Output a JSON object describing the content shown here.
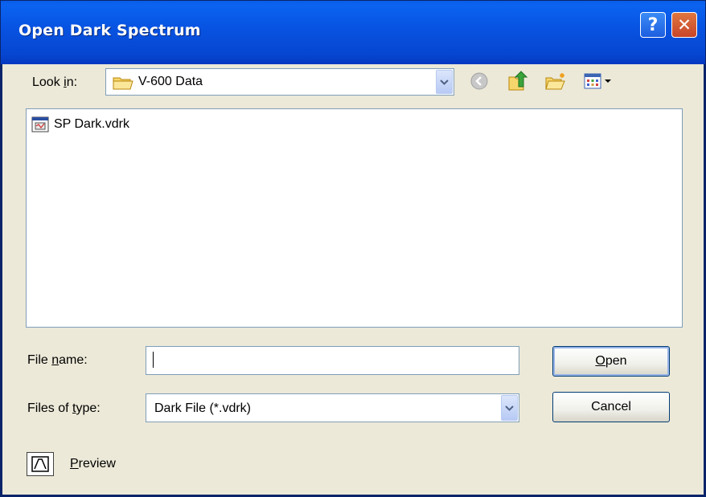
{
  "window": {
    "title": "Open Dark Spectrum",
    "help_glyph": "?",
    "close_glyph": "✕"
  },
  "look_in": {
    "label_prefix": "Look ",
    "label_accel": "i",
    "label_suffix": "n:",
    "value": "V-600 Data",
    "icon": "folder-icon"
  },
  "toolbar": {
    "icons": [
      "back-icon",
      "up-folder-icon",
      "new-folder-icon",
      "view-menu-icon"
    ]
  },
  "files": [
    {
      "name": "SP Dark.vdrk",
      "icon": "vdrk-file-icon"
    }
  ],
  "file_name": {
    "label_prefix": "File ",
    "label_accel": "n",
    "label_suffix": "ame:",
    "value": ""
  },
  "file_type": {
    "label_prefix": "Files of ",
    "label_accel": "t",
    "label_suffix": "ype:",
    "value": "Dark File (*.vdrk)"
  },
  "buttons": {
    "open_accel": "O",
    "open_rest": "pen",
    "cancel": "Cancel"
  },
  "preview": {
    "accel": "P",
    "rest": "review",
    "icon": "preview-icon"
  },
  "colors": {
    "title_bar": "#0854e3",
    "dialog_bg": "#ece9d8",
    "field_border": "#7f9db9",
    "close_button": "#d0502f"
  }
}
